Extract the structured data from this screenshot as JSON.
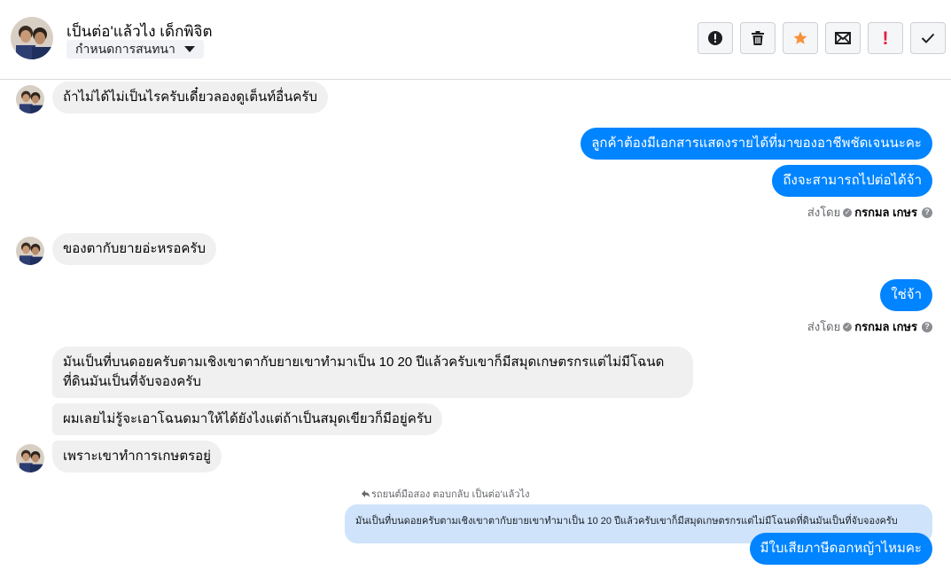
{
  "header": {
    "contact_name": "เป็นต่อ'แล้วไง เด็กพิจิต",
    "chat_menu_label": "กำหนดการสนทนา",
    "actions": [
      {
        "name": "report-spam-button",
        "icon": "alert-circle-icon"
      },
      {
        "name": "delete-button",
        "icon": "trash-icon"
      },
      {
        "name": "star-button",
        "icon": "star-icon"
      },
      {
        "name": "mark-unread-button",
        "icon": "envelope-icon"
      },
      {
        "name": "mark-important-button",
        "icon": "exclamation-icon"
      },
      {
        "name": "mark-done-button",
        "icon": "check-icon"
      }
    ]
  },
  "messages": [
    {
      "dir": "in",
      "text": "ถ้าไม่ได้ไม่เป็นไรครับเดี๋ยวลองดูเต็นท์อื่นครับ"
    },
    {
      "dir": "out",
      "text": "ลูกค้าต้องมีเอกสารแสดงรายได้ที่มาของอาชีพชัดเจนนะคะ"
    },
    {
      "dir": "out",
      "text": "ถึงจะสามารถไปต่อได้จ้า"
    },
    {
      "dir": "in",
      "text": "ของตากับยายอ่ะหรอครับ"
    },
    {
      "dir": "out",
      "text": "ใช่จ้า"
    },
    {
      "dir": "in",
      "text": "มันเป็นที่บนดอยครับตามเชิงเขาตากับยายเขาทำมาเป็น 10 20 ปีแล้วครับเขาก็มีสมุดเกษตรกรแต่ไม่มีโฉนด ที่ดินมันเป็นที่จับจองครับ"
    },
    {
      "dir": "in",
      "text": "ผมเลยไม่รู้จะเอาโฉนดมาให้ได้ยังไงแต่ถ้าเป็นสมุดเขียวก็มีอยู่ครับ"
    },
    {
      "dir": "in",
      "text": "เพราะเขาทำการเกษตรอยู่"
    },
    {
      "dir": "out",
      "text": "มีใบเสียภาษีดอกหญ้าไหมคะ"
    }
  ],
  "sent_status": {
    "prefix": "ส่งโดย",
    "sender": "กรกมล เกษร"
  },
  "reply": {
    "label": "รถยนต์มือสอง ตอบกลับ เป็นต่อ'แล้วไง",
    "quoted_text": "มันเป็นที่บนดอยครับตามเชิงเขาตากับยายเขาทำมาเป็น 10 20 ปีแล้วครับเขาก็มีสมุดเกษตรกรแต่ไม่มีโฉนดที่ดินมันเป็นที่จับจองครับ"
  },
  "colors": {
    "outgoing_bubble": "#0084ff",
    "incoming_bubble": "#f0f0f0",
    "star": "#f7923b",
    "important": "#e41e3f"
  }
}
